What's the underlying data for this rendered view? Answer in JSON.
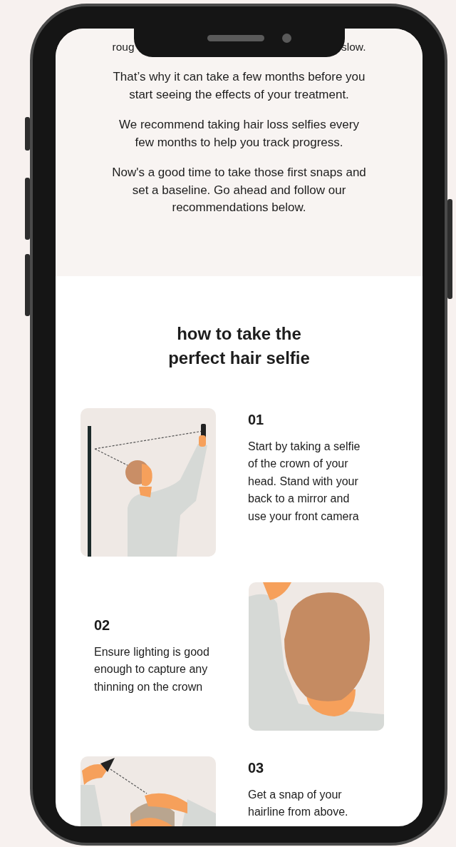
{
  "intro": {
    "notched_lines": [
      {
        "left": "roug",
        "right": "slow."
      }
    ],
    "paragraphs": [
      "That’s why it can take a few months before you start seeing the effects of your treatment.",
      "We recommend taking hair loss selfies every few months to help you track progress.",
      "Now's a good time to take those first snaps and set a baseline. Go ahead and follow our recommendations below."
    ]
  },
  "guide": {
    "heading_lines": [
      "how to take the",
      "perfect hair selfie"
    ],
    "steps": [
      {
        "kind": "mirror",
        "reversed": false,
        "number": "01",
        "text": "Start by taking a selfie of the crown of your head. Stand with your back to a mirror and use your front camera"
      },
      {
        "kind": "crown",
        "reversed": true,
        "number": "02",
        "text": "Ensure lighting is good enough to capture any thinning on the crown"
      },
      {
        "kind": "hairline",
        "reversed": false,
        "number": "03",
        "text": "Get a snap of your hairline from above."
      }
    ]
  }
}
